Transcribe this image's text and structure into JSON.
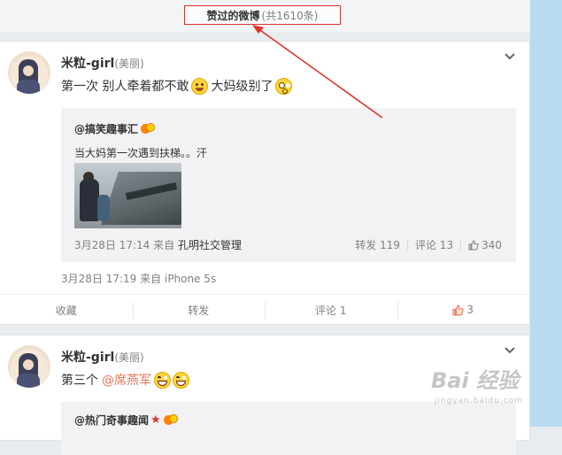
{
  "header": {
    "title": "赞过的微博",
    "count": "(共1610条)"
  },
  "posts": [
    {
      "username": "米粒-girl",
      "remark": "(美丽)",
      "text_parts": [
        "第一次 别人牵着都不敢",
        "大妈级别了"
      ],
      "repost": {
        "author": "@搞笑趣事汇",
        "text": "当大妈第一次遇到扶梯。。汗",
        "time": "3月28日 17:14",
        "via": "来自",
        "source": "孔明社交管理",
        "forward": "转发 119",
        "comment": "评论 13",
        "likes": "340"
      },
      "time": "3月28日 17:19",
      "via": "来自",
      "source": "iPhone 5s",
      "actions": {
        "favorite": "收藏",
        "forward": "转发",
        "comment": "评论 1",
        "likes": "3"
      }
    },
    {
      "username": "米粒-girl",
      "remark": "(美丽)",
      "text": "第三个",
      "mention": "@席燕军",
      "repost_author": "@热门奇事趣闻"
    }
  ],
  "watermark": {
    "brand": "Bai 经验",
    "url": "jingyan.baidu.com"
  },
  "icons": [
    "chevron-down-icon",
    "thumbs-up-icon",
    "emoji-icon",
    "verified-badge-icon"
  ],
  "colors": {
    "accent": "#eb7350",
    "highlight_border": "#e0322c",
    "side_band": "#b7dbf1"
  }
}
